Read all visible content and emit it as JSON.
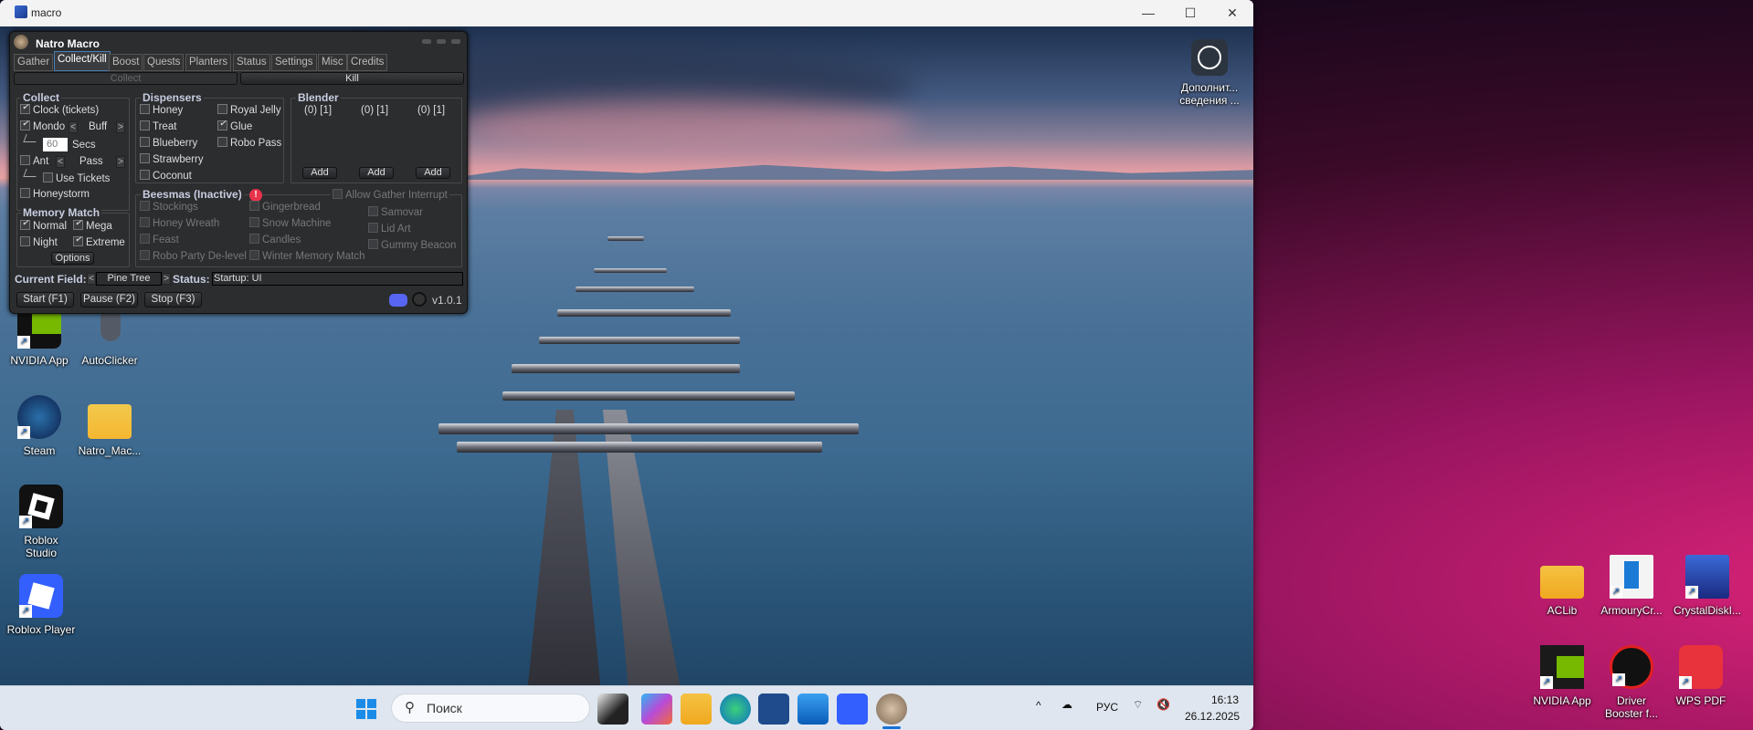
{
  "vm_window": {
    "title": "macro",
    "minimize": "—",
    "maximize": "☐",
    "close": "✕"
  },
  "natro": {
    "title": "Natro Macro",
    "tabs": [
      "Gather",
      "Collect/Kill",
      "Boost",
      "Quests",
      "Planters",
      "Status",
      "Settings",
      "Misc",
      "Credits"
    ],
    "active_tab": "Collect/Kill",
    "subtabs": {
      "collect": "Collect",
      "kill": "Kill"
    },
    "collect": {
      "title": "Collect",
      "clock": "Clock (tickets)",
      "clock_checked": true,
      "mondo": "Mondo",
      "mondo_checked": true,
      "mondo_option": "Buff",
      "secs_value": "60",
      "secs_label": "Secs",
      "ant": "Ant",
      "ant_checked": false,
      "ant_option": "Pass",
      "use_tickets": "Use Tickets",
      "honeystorm": "Honeystorm"
    },
    "memory_match": {
      "title": "Memory Match",
      "normal": "Normal",
      "mega": "Mega",
      "night": "Night",
      "extreme": "Extreme",
      "options": "Options",
      "normal_checked": true,
      "mega_checked": true,
      "night_checked": false,
      "extreme_checked": true
    },
    "dispensers": {
      "title": "Dispensers",
      "items": [
        {
          "label": "Honey",
          "checked": false
        },
        {
          "label": "Treat",
          "checked": false
        },
        {
          "label": "Blueberry",
          "checked": false
        },
        {
          "label": "Strawberry",
          "checked": false
        },
        {
          "label": "Coconut",
          "checked": false
        },
        {
          "label": "Royal Jelly",
          "checked": false
        },
        {
          "label": "Glue",
          "checked": true
        },
        {
          "label": "Robo Pass",
          "checked": false
        }
      ]
    },
    "blender": {
      "title": "Blender",
      "slots": [
        "(0) [1]",
        "(0) [1]",
        "(0) [1]"
      ],
      "add": "Add"
    },
    "beesmas": {
      "title": "Beesmas (Inactive)",
      "allow_interrupt": "Allow Gather Interrupt",
      "items": [
        "Stockings",
        "Honey Wreath",
        "Feast",
        "Robo Party De-level",
        "Gingerbread",
        "Snow Machine",
        "Candles",
        "Winter Memory Match",
        "Samovar",
        "Lid Art",
        "Gummy Beacon"
      ]
    },
    "current_field_label": "Current Field:",
    "current_field": "Pine Tree",
    "status_label": "Status:",
    "status": "Startup: UI",
    "start": "Start (F1)",
    "pause": "Pause (F2)",
    "stop": "Stop (F3)",
    "version": "v1.0.1"
  },
  "vm_desktop_icons": [
    {
      "label": "NVIDIA App"
    },
    {
      "label": "AutoClicker"
    },
    {
      "label": "Steam"
    },
    {
      "label": "Natro_Mac..."
    },
    {
      "label": "Roblox Studio"
    },
    {
      "label": "Roblox Player"
    },
    {
      "label": "Дополнит... сведения ..."
    }
  ],
  "taskbar": {
    "search_placeholder": "Поиск",
    "lang": "РУС",
    "time": "16:13",
    "date": "26.12.2025",
    "apps": [
      "Task View",
      "Microsoft 365",
      "File Explorer",
      "Edge",
      "Microsoft Store",
      "Outlook",
      "Roblox",
      "Natro Macro"
    ]
  },
  "host_desktop_icons": [
    {
      "label": "ACLib"
    },
    {
      "label": "ArmouryCr..."
    },
    {
      "label": "CrystalDiskI..."
    },
    {
      "label": "NVIDIA App"
    },
    {
      "label": "Driver Booster f..."
    },
    {
      "label": "WPS PDF"
    }
  ]
}
